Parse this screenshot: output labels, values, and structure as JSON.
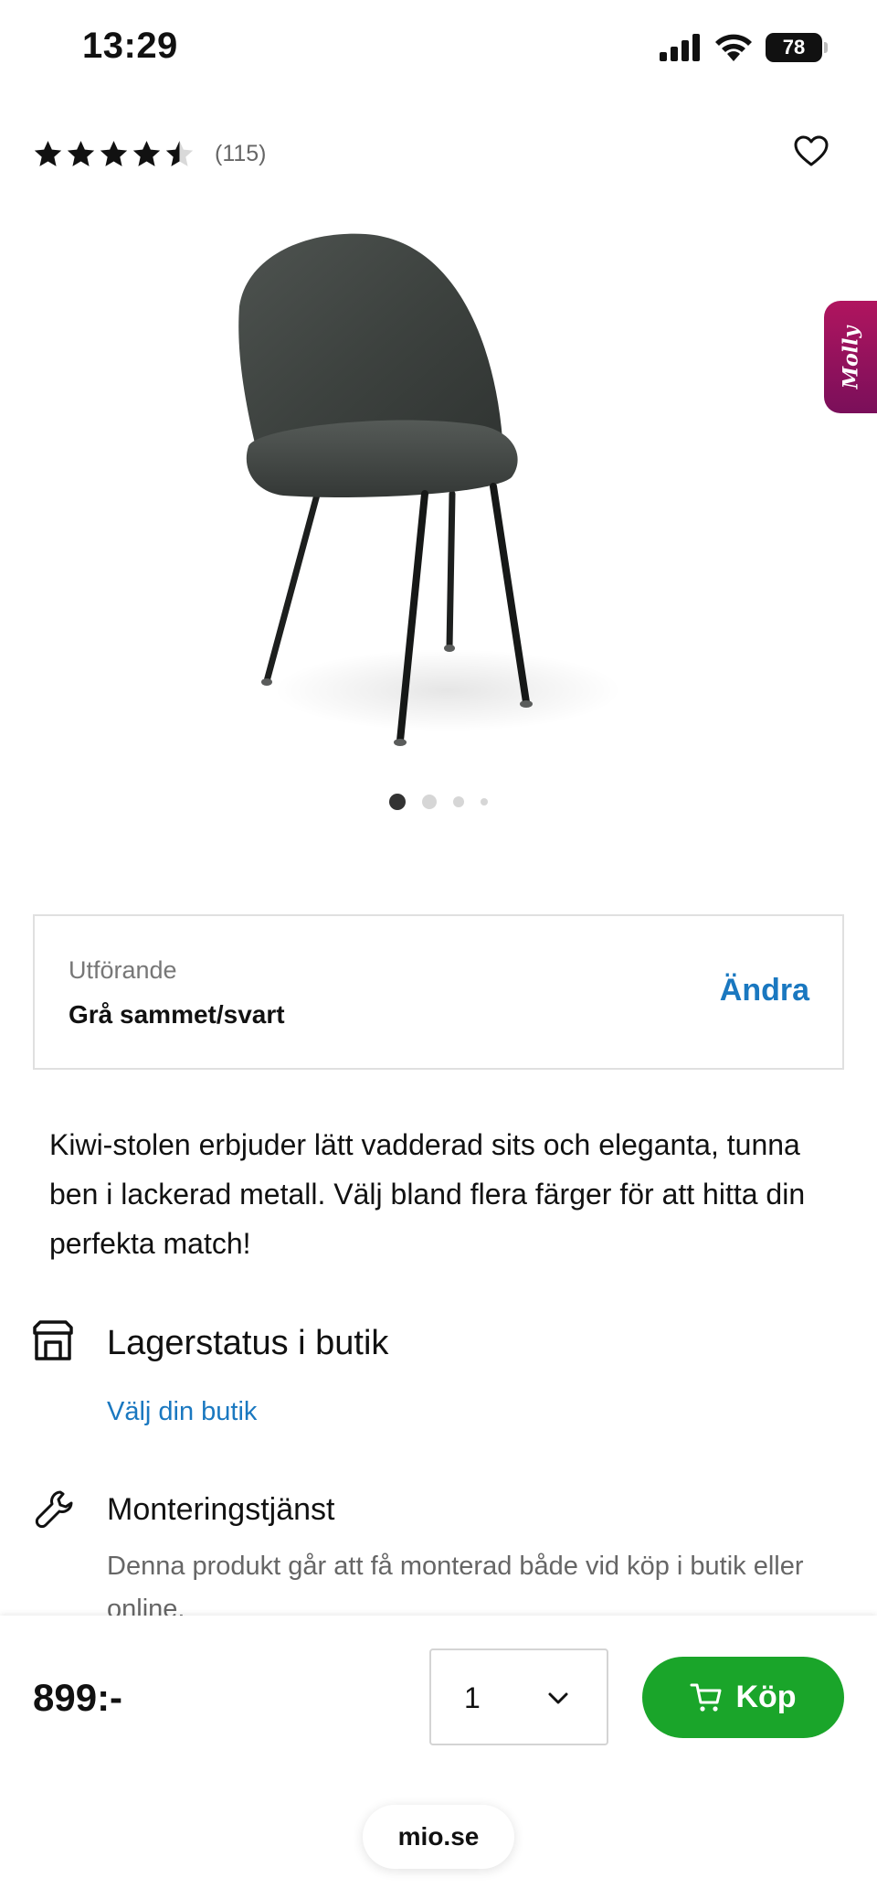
{
  "status_bar": {
    "time": "13:29",
    "battery": "78"
  },
  "product": {
    "rating": 4.5,
    "review_count": "(115)",
    "image_dots": 4,
    "active_dot": 0
  },
  "molly": {
    "label": "Molly"
  },
  "variant": {
    "label": "Utförande",
    "value": "Grå sammet/svart",
    "change_label": "Ändra"
  },
  "description": "Kiwi-stolen erbjuder lätt vadderad sits och eleganta, tunna ben i lackerad metall. Välj bland flera färger för att hitta din perfekta match!",
  "stock": {
    "title": "Lagerstatus i butik",
    "link": "Välj din butik"
  },
  "assembly": {
    "title": "Monteringstjänst",
    "description": "Denna produkt går att få monterad både vid köp i butik eller online."
  },
  "buy_bar": {
    "price": "899:-",
    "quantity": "1",
    "buy_label": "Köp"
  },
  "browser": {
    "url": "mio.se"
  },
  "colors": {
    "link_blue": "#1a78c0",
    "buy_green": "#1aa52a",
    "molly_magenta": "#b0155f"
  }
}
